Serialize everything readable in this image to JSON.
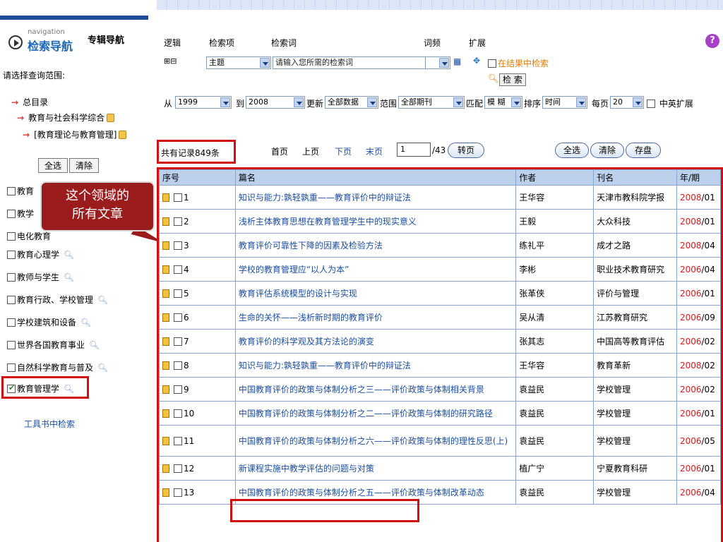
{
  "sidebar": {
    "nav_small": "navigation",
    "nav_big": "检索导航",
    "nav_topic": "专辑导航",
    "scope_label": "请选择查询范围:",
    "tree": [
      {
        "label": "总目录"
      },
      {
        "label": "教育与社会科学综合"
      },
      {
        "label": "[教育理论与教育管理]"
      }
    ],
    "select_all": "全选",
    "clear": "清除",
    "categories": [
      {
        "label": "教育"
      },
      {
        "label": "教学"
      },
      {
        "label": "电化教育"
      },
      {
        "label": "教育心理学"
      },
      {
        "label": "教师与学生"
      },
      {
        "label": "教育行政、学校管理"
      },
      {
        "label": "学校建筑和设备"
      },
      {
        "label": "世界各国教育事业"
      },
      {
        "label": "自然科学教育与普及"
      },
      {
        "label": "教育管理学",
        "checked": true
      }
    ],
    "tool_link": "工具书中检索"
  },
  "callout": {
    "line1": "这个领域的",
    "line2": "所有文章"
  },
  "search": {
    "h_logic": "逻辑",
    "h_field": "检索项",
    "h_term": "检索词",
    "h_freq": "词频",
    "h_ext": "扩展",
    "field_value": "主题",
    "term_placeholder": "请输入您所需的检索词",
    "in_results": "在结果中检索",
    "search_btn": "检 索",
    "from_label": "从",
    "from_year": "1999",
    "to_label": "到",
    "to_year": "2008",
    "update_label": "更新",
    "update_value": "全部数据",
    "range_label": "范围",
    "range_value": "全部期刊",
    "match_label": "匹配",
    "match_value": "模 糊",
    "sort_label": "排序",
    "sort_value": "时间",
    "per_page_label": "每页",
    "per_page_value": "20",
    "cn_en_label": "中英扩展"
  },
  "results": {
    "count_text": "共有记录849条",
    "first": "首页",
    "prev": "上页",
    "next": "下页",
    "last": "末页",
    "page": "1",
    "total_pages": "/43",
    "goto": "转页",
    "select_all": "全选",
    "clear": "清除",
    "save": "存盘"
  },
  "table": {
    "headers": {
      "no": "序号",
      "title": "篇名",
      "author": "作者",
      "journal": "刊名",
      "year": "年/期"
    },
    "rows": [
      {
        "no": "1",
        "title": "知识与能力:孰轻孰重——教育评价中的辩证法",
        "author": "王华容",
        "journal": "天津市教科院学报",
        "year": "2008",
        "issue": "/01"
      },
      {
        "no": "2",
        "title": "浅析主体教育思想在教育管理学生中的现实意义",
        "author": "王毅",
        "journal": "大众科技",
        "year": "2008",
        "issue": "/01"
      },
      {
        "no": "3",
        "title": "教育评价可靠性下降的因素及检验方法",
        "author": "练礼平",
        "journal": "成才之路",
        "year": "2008",
        "issue": "/04"
      },
      {
        "no": "4",
        "title": "学校的教育管理应“以人为本”",
        "author": "李彬",
        "journal": "职业技术教育研究",
        "year": "2006",
        "issue": "/04"
      },
      {
        "no": "5",
        "title": "教育评估系统模型的设计与实现",
        "author": "张革侠",
        "journal": "评价与管理",
        "year": "2006",
        "issue": "/01"
      },
      {
        "no": "6",
        "title": "生命的关怀——浅析新时期的教育评价",
        "author": "吴从清",
        "journal": "江苏教育研究",
        "year": "2006",
        "issue": "/09"
      },
      {
        "no": "7",
        "title": "教育评价的科学观及其方法论的演变",
        "author": "张其志",
        "journal": "中国高等教育评估",
        "year": "2006",
        "issue": "/02"
      },
      {
        "no": "8",
        "title": "知识与能力:孰轻孰重——教育评价中的辩证法",
        "author": "王华容",
        "journal": "教育革新",
        "year": "2008",
        "issue": "/02"
      },
      {
        "no": "9",
        "title": "中国教育评价的政策与体制分析之三——评价政策与体制相关背景",
        "author": "袁益民",
        "journal": "学校管理",
        "year": "2006",
        "issue": "/02"
      },
      {
        "no": "10",
        "title": "中国教育评价的政策与体制分析之二——评价政策与体制的研究路径",
        "author": "袁益民",
        "journal": "学校管理",
        "year": "2006",
        "issue": "/01"
      },
      {
        "no": "11",
        "title": "中国教育评价的政策与体制分析之六——评价政策与体制的理性反思(上)",
        "author": "袁益民",
        "journal": "学校管理",
        "year": "2006",
        "issue": "/05"
      },
      {
        "no": "12",
        "title": "新课程实施中教学评估的问题与对策",
        "author": "植广宁",
        "journal": "宁夏教育科研",
        "year": "2006",
        "issue": "/01"
      },
      {
        "no": "13",
        "title": "中国教育评价的政策与体制分析之五——评价政策与体制改革动态",
        "author": "袁益民",
        "journal": "学校管理",
        "year": "2006",
        "issue": "/04"
      }
    ]
  },
  "colors": {
    "accent_red": "#d01010",
    "link_blue": "#1a4ea3",
    "header_bg": "#bcd0ec",
    "callout_bg": "#9b1c1c"
  }
}
